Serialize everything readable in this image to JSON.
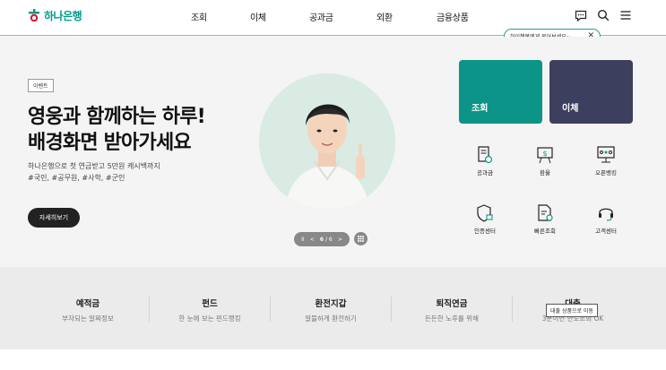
{
  "header": {
    "logo_text": "하나은행",
    "nav": [
      "조회",
      "이체",
      "공과금",
      "외환",
      "금융상품"
    ],
    "chat_bubble": "하이챗봇에게 물어보세요~",
    "chat_close": "✕"
  },
  "hero": {
    "event_tag": "이벤트",
    "title_line1": "영웅과 함께하는 하루!",
    "title_line2": "배경화면 받아가세요",
    "desc_line1": "하나은행으로 첫 연금받고 5만원 캐시백까지",
    "desc_line2": "#국민, #공무원, #사학, #군인",
    "cta": "자세히보기",
    "pager": {
      "pause": "II",
      "prev": "<",
      "current": "6",
      "total": "6",
      "next": ">"
    }
  },
  "cards": {
    "inquiry": "조회",
    "transfer": "이체"
  },
  "quick_menu": [
    "공과금",
    "환율",
    "오픈뱅킹",
    "인증센터",
    "빠른조회",
    "고객센터"
  ],
  "band": [
    {
      "title": "예적금",
      "sub": "부자되는 알짜정보"
    },
    {
      "title": "펀드",
      "sub": "한 눈에 보는 펀드랭킹"
    },
    {
      "title": "환전지갑",
      "sub": "알뜰하게 환전하기"
    },
    {
      "title": "퇴직연금",
      "sub": "든든한 노후를 위해"
    },
    {
      "title": "대출",
      "sub": "3분이면 한도조회 OK"
    }
  ],
  "tooltip": "대출 상품으로 이동",
  "colors": {
    "brand": "#009a8a",
    "card_teal": "#0d9488",
    "card_navy": "#3d3f5e"
  }
}
